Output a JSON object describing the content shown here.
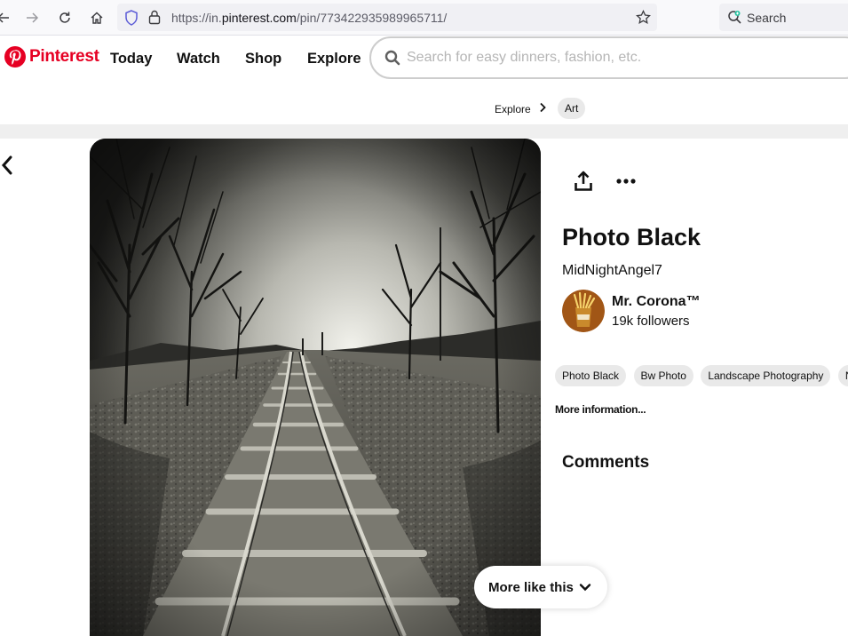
{
  "browser": {
    "url_prefix": "https://in.",
    "url_domain": "pinterest.com",
    "url_path": "/pin/773422935989965711/",
    "search_label": "Search"
  },
  "header": {
    "logo_text": "Pinterest",
    "nav": [
      "Today",
      "Watch",
      "Shop",
      "Explore"
    ],
    "search_placeholder": "Search for easy dinners, fashion, etc.",
    "brand_color": "#e60023"
  },
  "breadcrumb": {
    "items": [
      "Explore",
      "Art"
    ]
  },
  "pin": {
    "title": "Photo Black",
    "source": "MidNightAngel7",
    "creator": {
      "name": "Mr. Corona™",
      "followers": "19k followers"
    },
    "tags": [
      "Photo Black",
      "Bw Photo",
      "Landscape Photography",
      "Nature"
    ],
    "more_info": "More information...",
    "comments_heading": "Comments",
    "more_like_this": "More like this"
  },
  "icons": {
    "share": "share-icon",
    "more": "ellipsis-icon",
    "back": "chevron-left-icon"
  }
}
